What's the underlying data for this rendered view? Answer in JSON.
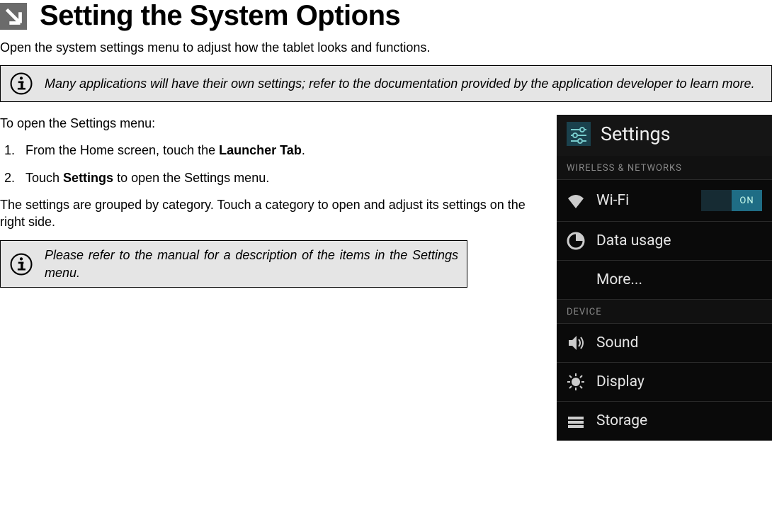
{
  "title": "Setting the System Options",
  "intro": "Open the system settings menu to adjust how the tablet looks and functions.",
  "info1": "Many applications will have their own settings; refer to the documentation provided by the application developer to learn more.",
  "lead": "To open the Settings menu:",
  "step1_pre": "From the Home screen, touch the ",
  "step1_bold": "Launcher Tab",
  "step1_post": ".",
  "step2_pre": "Touch ",
  "step2_bold": "Settings",
  "step2_post": " to open the Settings menu.",
  "para2": "The settings are grouped by category. Touch a category to open and adjust its settings on the right side.",
  "info2": "Please refer to the manual for a description of the items in the Settings menu.",
  "phone": {
    "title": "Settings",
    "section1": "WIRELESS & NETWORKS",
    "wifi": "Wi-Fi",
    "wifi_toggle": "ON",
    "data": "Data usage",
    "more": "More...",
    "section2": "DEVICE",
    "sound": "Sound",
    "display": "Display",
    "storage": "Storage"
  }
}
